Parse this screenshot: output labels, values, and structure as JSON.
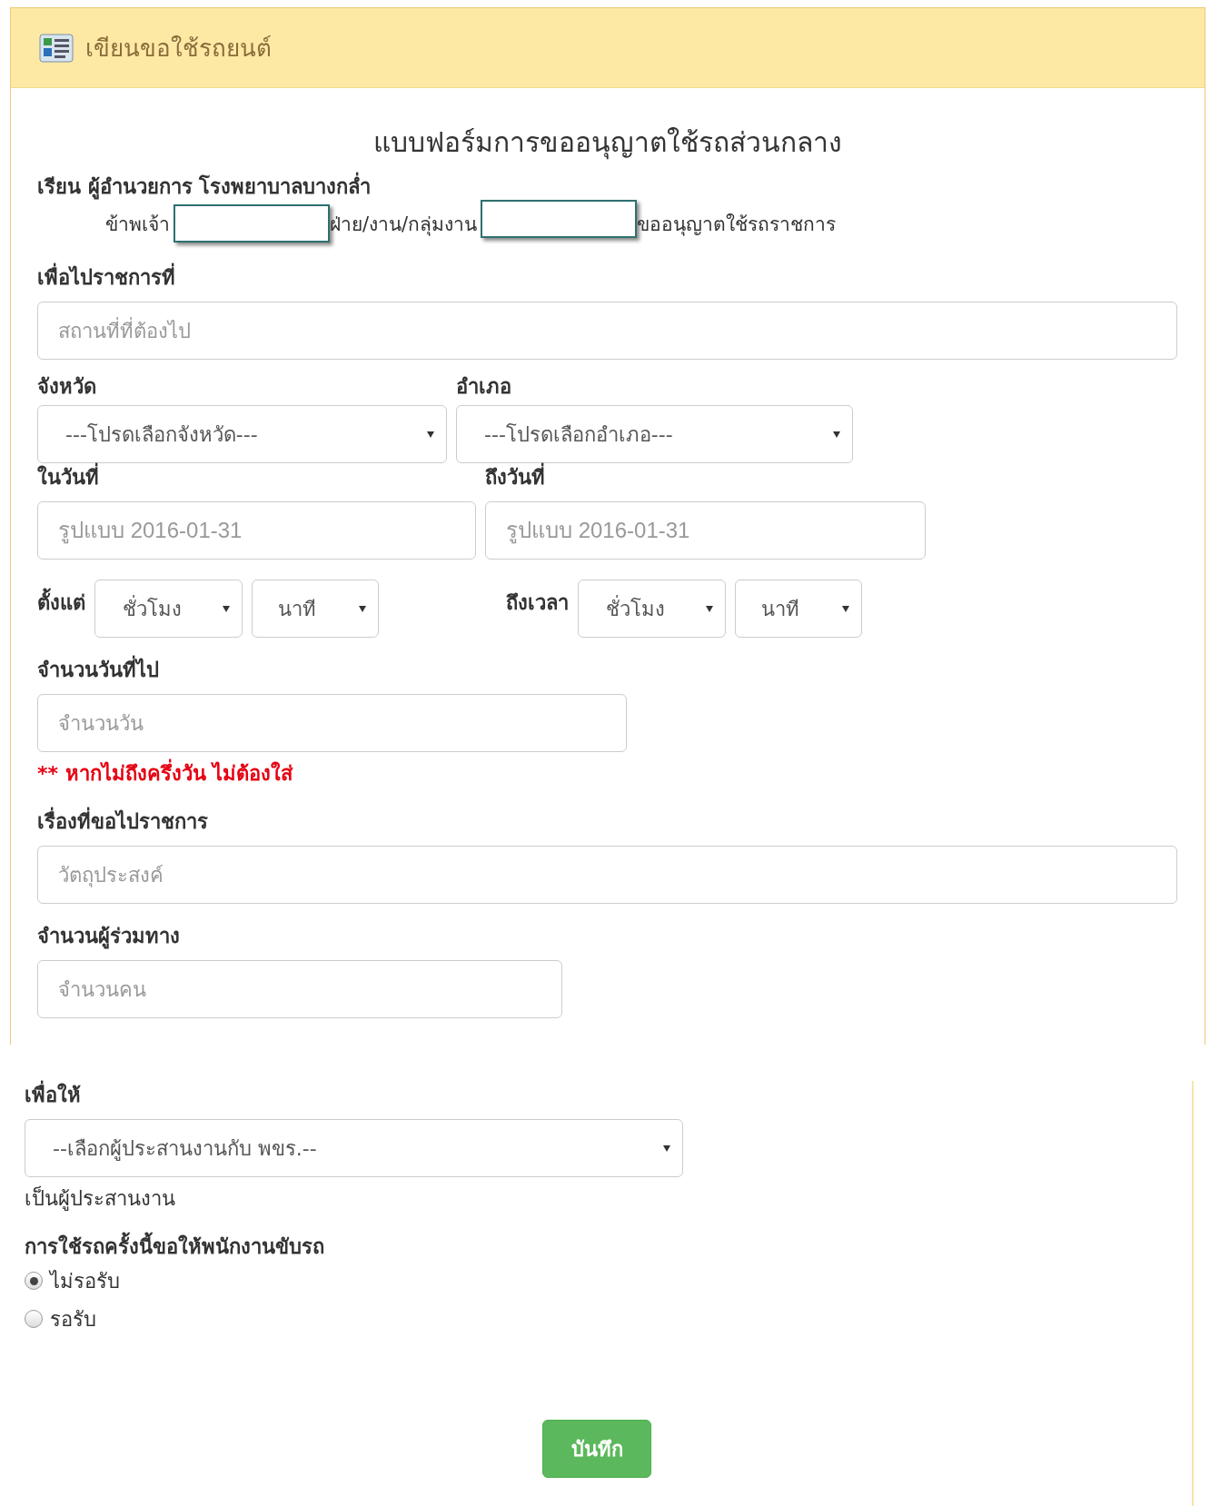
{
  "panel": {
    "title": "เขียนขอใช้รถยนต์"
  },
  "form": {
    "heading": "แบบฟอร์มการขออนุญาตใช้รถส่วนกลาง",
    "salutation": "เรียน ผู้อำนวยการ โรงพยาบาลบางกล่ำ",
    "request_line": [
      {
        "kind": "text",
        "text": "ข้าพเจ้า"
      },
      {
        "kind": "input"
      },
      {
        "kind": "text",
        "text": "ฝ่าย/งาน/กลุ่มงาน"
      },
      {
        "kind": "input"
      },
      {
        "kind": "text",
        "text": "ขออนุญาตใช้รถราชการ"
      }
    ],
    "destination": {
      "label": "เพื่อไปราชการที่",
      "placeholder": "สถานที่ที่ต้องไป"
    },
    "province": {
      "label": "จังหวัด",
      "value": "---โปรดเลือกจังหวัด---"
    },
    "district": {
      "label": "อำเภอ",
      "value": "---โปรดเลือกอำเภอ---"
    },
    "start_date": {
      "label": "ในวันที่",
      "placeholder": "รูปแบบ 2016-01-31"
    },
    "end_date": {
      "label": "ถึงวันที่",
      "placeholder": "รูปแบบ 2016-01-31"
    },
    "time_from": {
      "label": "ตั้งแต่",
      "hour": "ชั่วโมง",
      "minute": "นาที"
    },
    "time_to": {
      "label": "ถึงเวลา",
      "hour": "ชั่วโมง",
      "minute": "นาที"
    },
    "days": {
      "label": "จำนวนวันที่ไป",
      "placeholder": "จำนวนวัน",
      "note": "** หากไม่ถึงครึ่งวัน ไม่ต้องใส่"
    },
    "purpose": {
      "label": "เรื่องที่ขอไปราชการ",
      "placeholder": "วัตถุประสงค์"
    },
    "passengers": {
      "label": "จำนวนผู้ร่วมทาง",
      "placeholder": "จำนวนคน"
    }
  },
  "lower": {
    "assign": {
      "label": "เพื่อให้",
      "value": "--เลือกผู้ประสานงานกับ พขร.--",
      "suffix": "เป็นผู้ประสานงาน"
    },
    "driver": {
      "label": "การใช้รถครั้งนี้ขอให้พนักงานขับรถ",
      "options": [
        {
          "label": "ไม่รอรับ",
          "selected": true
        },
        {
          "label": "รอรับ",
          "selected": false
        }
      ]
    },
    "submit": "บันทึก"
  }
}
